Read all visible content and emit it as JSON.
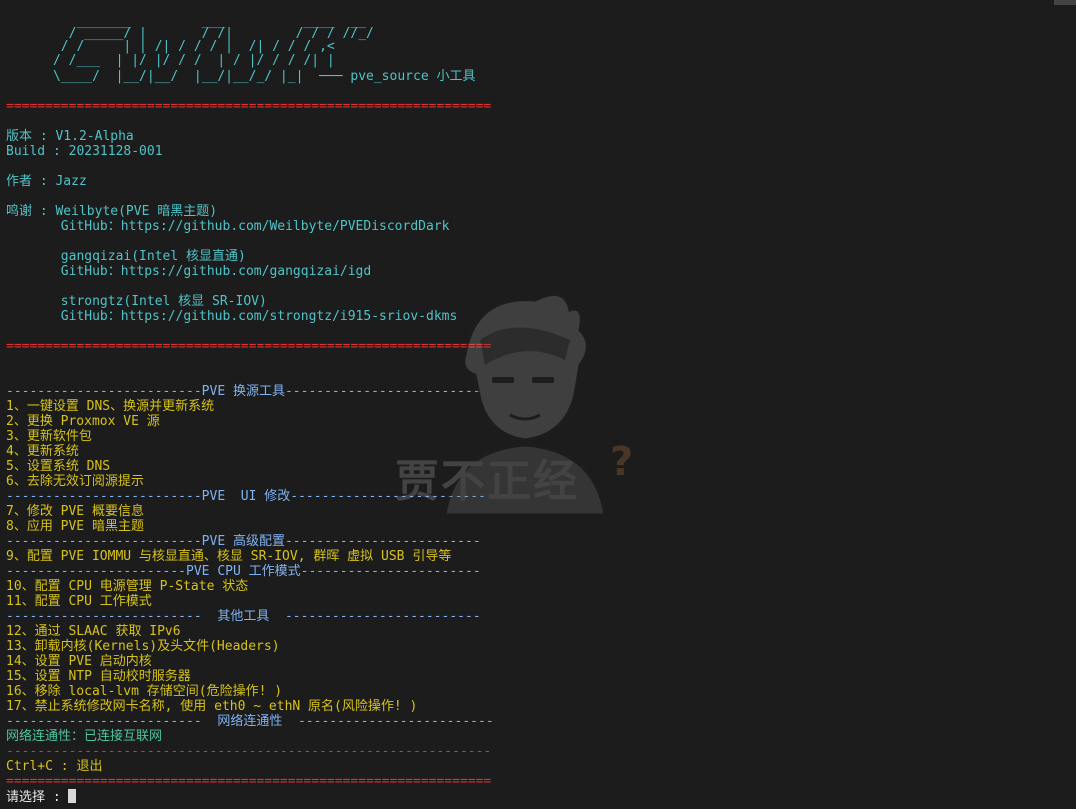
{
  "logo": [
    "         _______         ___          ____  __",
    "        / _____/ |       / /|        / / / //_/",
    "       / /     | | /| / / / |  /| / / / ,<",
    "      / /___  | |/ |/ / /  | / |/ / / /| |",
    "      \\____/  |__/|__/  |__/|__/_/ |_|  ─── pve_source 小工具"
  ],
  "separator_double": "==============================================================",
  "info": {
    "version": "版本 : V1.2-Alpha",
    "build": "Build : 20231128-001",
    "author": "作者 : Jazz",
    "thanks_1": "鸣谢 : Weilbyte(PVE 暗黑主题)",
    "thanks_1_link": "       GitHub：https://github.com/Weilbyte/PVEDiscordDark",
    "thanks_2": "       gangqizai(Intel 核显直通)",
    "thanks_2_link": "       GitHub：https://github.com/gangqizai/igd",
    "thanks_3": "       strongtz(Intel 核显 SR-IOV)",
    "thanks_3_link": "       GitHub：https://github.com/strongtz/i915-sriov-dkms"
  },
  "sections": {
    "pve_source": "-------------------------PVE 换源工具-------------------------",
    "ui_mod": "-------------------------PVE  UI 修改-------------------------",
    "advanced": "-------------------------PVE 高级配置-------------------------",
    "cpu_mode": "-----------------------PVE CPU 工作模式-----------------------",
    "other_tools": "-------------------------  其他工具  -------------------------",
    "network": "-------------------------  网络连通性  -------------------------",
    "dash_line": "--------------------------------------------------------------"
  },
  "menu": {
    "item_1": "1、一键设置 DNS、换源并更新系统",
    "item_2": "2、更换 Proxmox VE 源",
    "item_3": "3、更新软件包",
    "item_4": "4、更新系统",
    "item_5": "5、设置系统 DNS",
    "item_6": "6、去除无效订阅源提示",
    "item_7": "7、修改 PVE 概要信息",
    "item_8": "8、应用 PVE 暗黑主题",
    "item_9": "9、配置 PVE IOMMU 与核显直通、核显 SR-IOV, 群晖 虚拟 USB 引导等",
    "item_10": "10、配置 CPU 电源管理 P-State 状态",
    "item_11": "11、配置 CPU 工作模式",
    "item_12": "12、通过 SLAAC 获取 IPv6",
    "item_13": "13、卸载内核(Kernels)及头文件(Headers)",
    "item_14": "14、设置 PVE 启动内核",
    "item_15": "15、设置 NTP 自动校时服务器",
    "item_16": "16、移除 local-lvm 存储空间(危险操作! )",
    "item_17": "17、禁止系统修改网卡名称, 使用 eth0 ~ ethN 原名(风险操作! )"
  },
  "network_status": "网络连通性：已连接互联网",
  "exit_hint": "Ctrl+C : 退出",
  "prompt": "请选择 : ",
  "watermark": "贾不正经"
}
